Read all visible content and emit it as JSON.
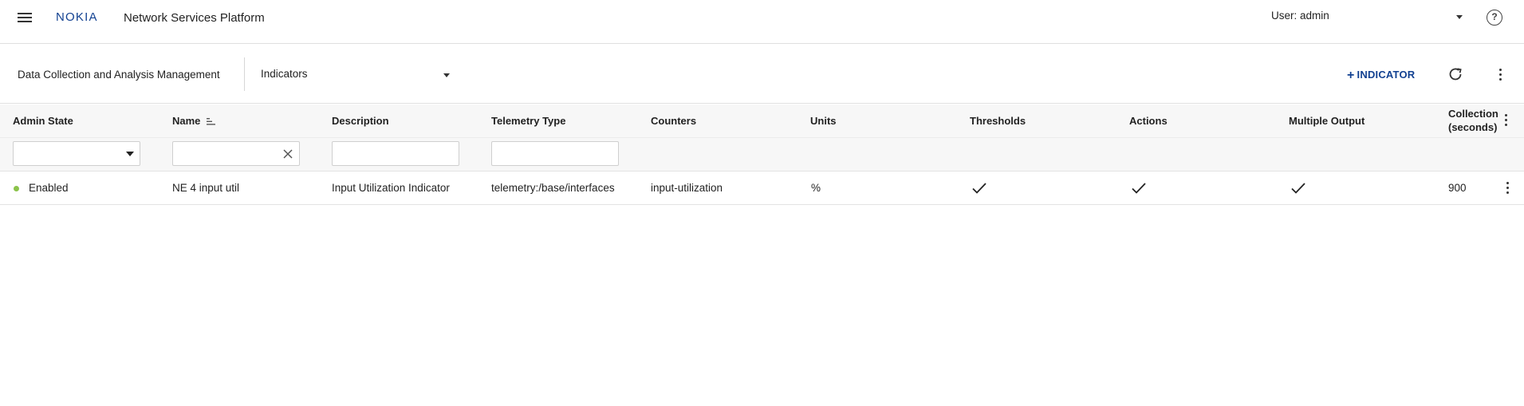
{
  "header": {
    "logo_text": "NOKIA",
    "app_title": "Network Services Platform",
    "user_label": "User: admin",
    "help_glyph": "?"
  },
  "toolbar": {
    "breadcrumb": "Data Collection and Analysis Management",
    "view_selected": "Indicators",
    "add_button_plus": "+",
    "add_button_label": "INDICATOR"
  },
  "table": {
    "columns": [
      "Admin State",
      "Name",
      "Description",
      "Telemetry Type",
      "Counters",
      "Units",
      "Thresholds",
      "Actions",
      "Multiple Output",
      "Collection (seconds)"
    ],
    "collection_header_line1": "Collection",
    "collection_header_line2": "(seconds)",
    "filters": {
      "admin_state": "",
      "name": "",
      "description": "",
      "telemetry_type": ""
    },
    "rows": [
      {
        "admin_state": "Enabled",
        "name": "NE 4 input util",
        "description": "Input Utilization Indicator",
        "telemetry_type": "telemetry:/base/interfaces",
        "counters": "input-utilization",
        "units": "%",
        "thresholds": true,
        "actions": true,
        "multiple_output": true,
        "collection": "900"
      }
    ]
  },
  "colors": {
    "brand": "#124191",
    "enabled_status": "#8bc34a",
    "header_bg": "#f7f7f7"
  }
}
